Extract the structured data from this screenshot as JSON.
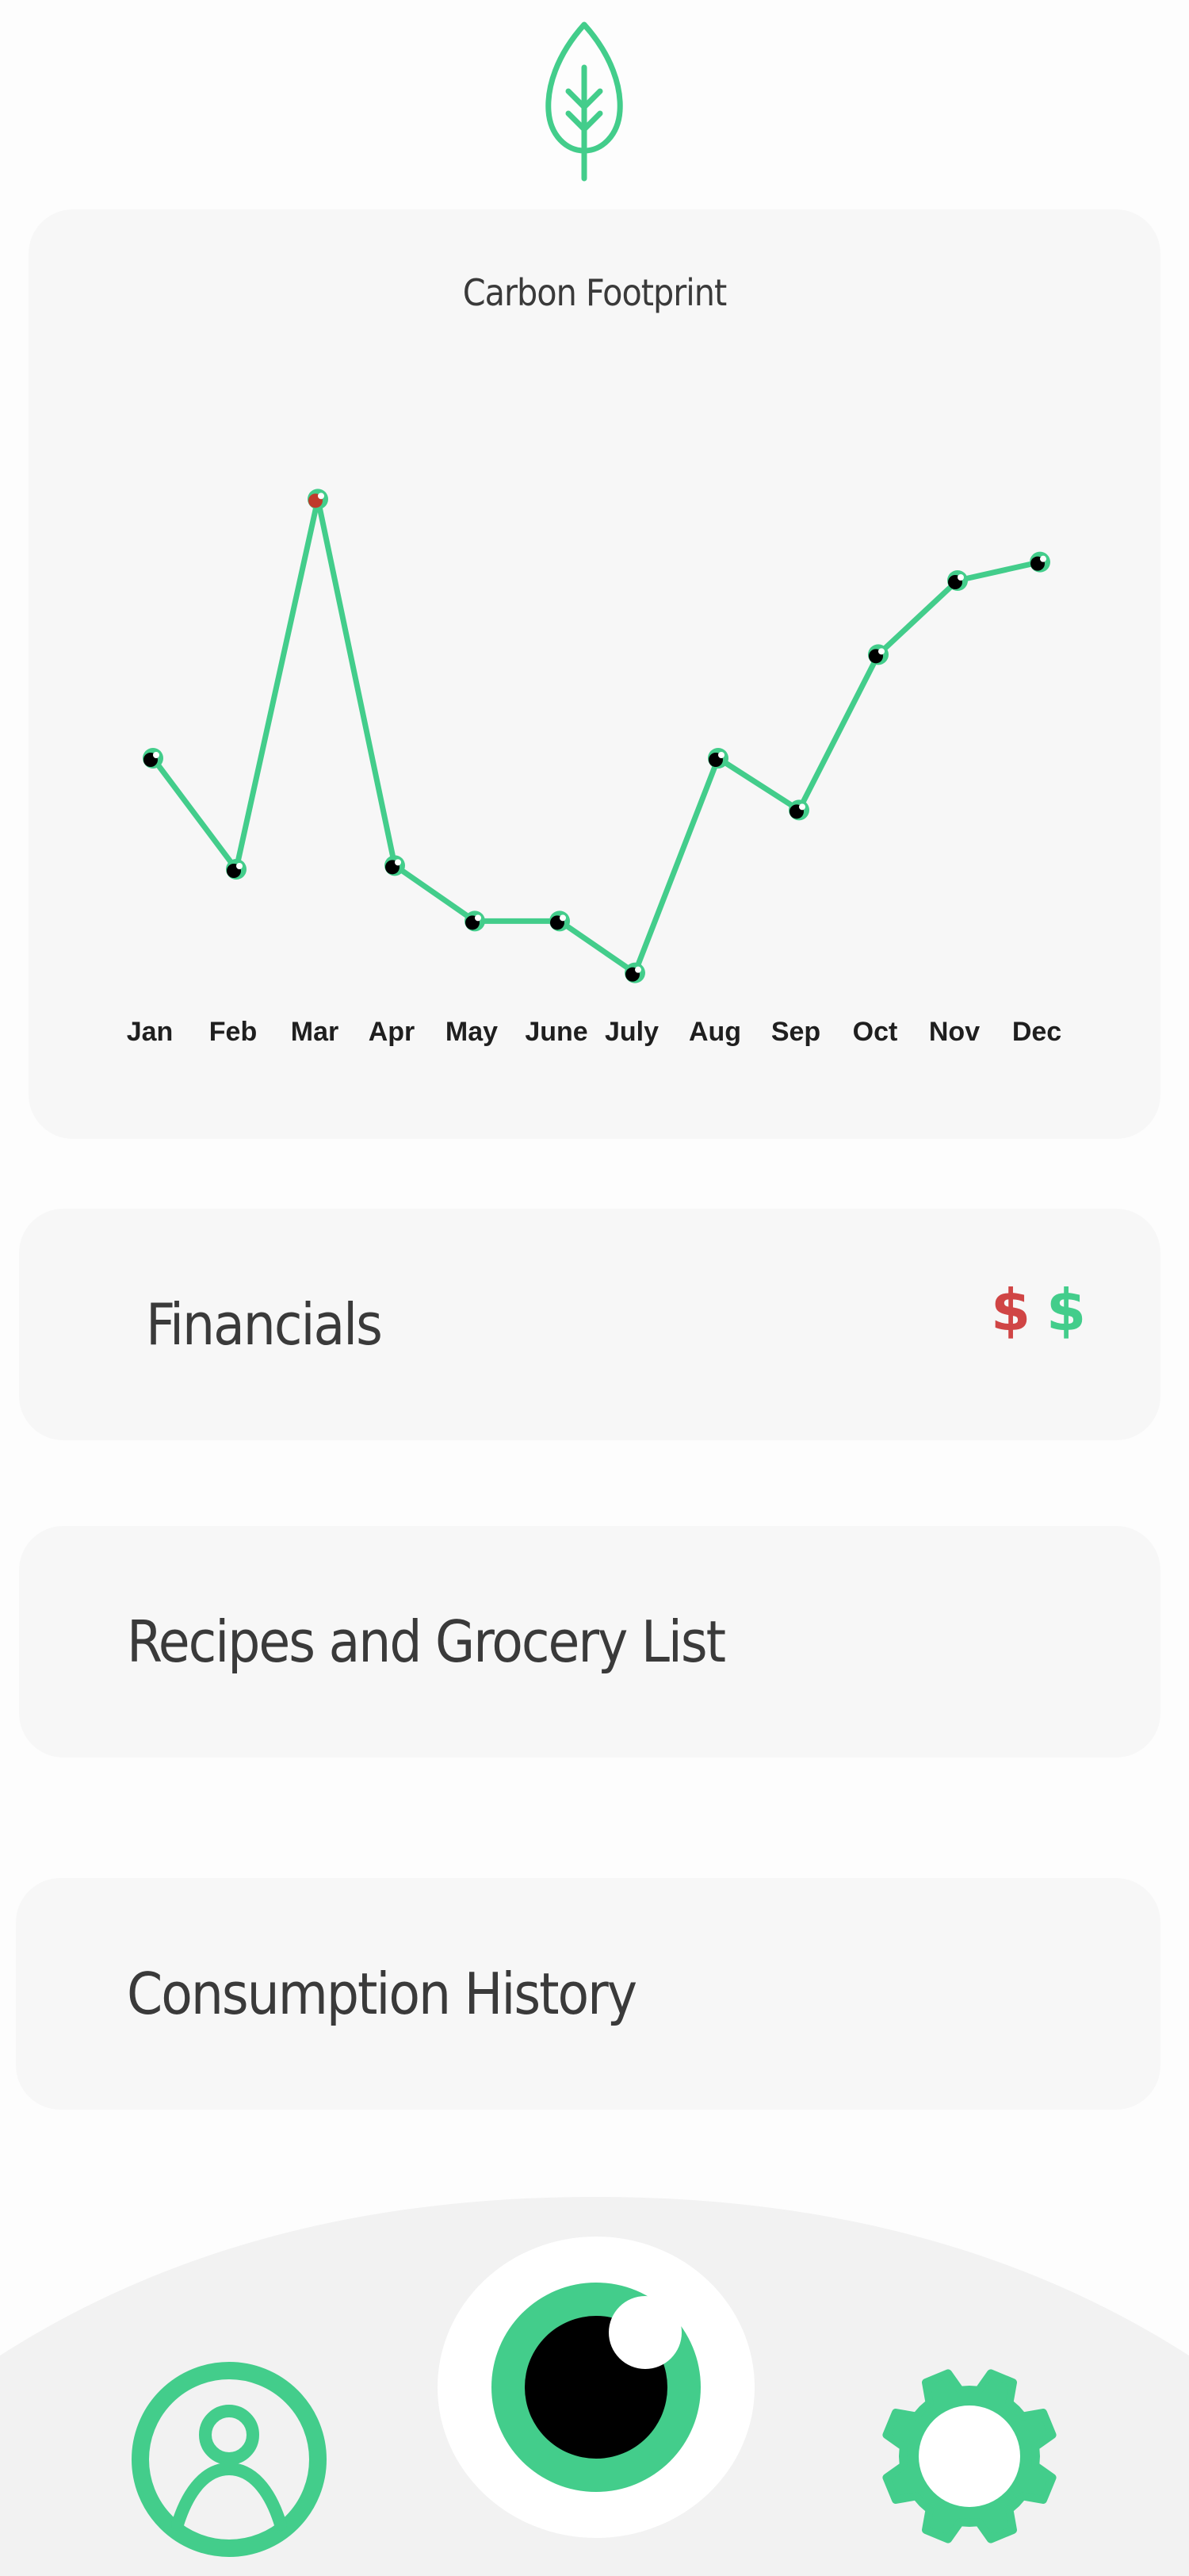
{
  "header": {
    "logo_icon": "leaf-icon"
  },
  "chart_card": {
    "title": "Carbon Footprint"
  },
  "chart_data": {
    "type": "line",
    "title": "Carbon Footprint",
    "categories": [
      "Jan",
      "Feb",
      "Mar",
      "Apr",
      "May",
      "June",
      "July",
      "Aug",
      "Sep",
      "Oct",
      "Nov",
      "Dec"
    ],
    "values": [
      48,
      33,
      83,
      33.5,
      26,
      26,
      19,
      48,
      41,
      62,
      72,
      74.5
    ],
    "highlight_index": 2,
    "line_color": "#43cd8b",
    "highlight_color": "#c0392b",
    "point_color": "#000000",
    "grid": false,
    "xlabel": "",
    "ylabel": ""
  },
  "menu": {
    "financials": {
      "label": "Financials",
      "dollar_down": "$",
      "dollar_up": "$"
    },
    "recipes": {
      "label": "Recipes and Grocery List"
    },
    "consumption": {
      "label": "Consumption History"
    }
  },
  "dock": {
    "left_icon": "profile-icon",
    "center_icon": "eye-icon",
    "right_icon": "settings-gear-icon"
  },
  "colors": {
    "accent": "#43cd8b",
    "negative": "#d04545",
    "card_bg": "#f7f7f7",
    "dock_bg": "#f2f2f2",
    "text": "#3a3a3a"
  }
}
